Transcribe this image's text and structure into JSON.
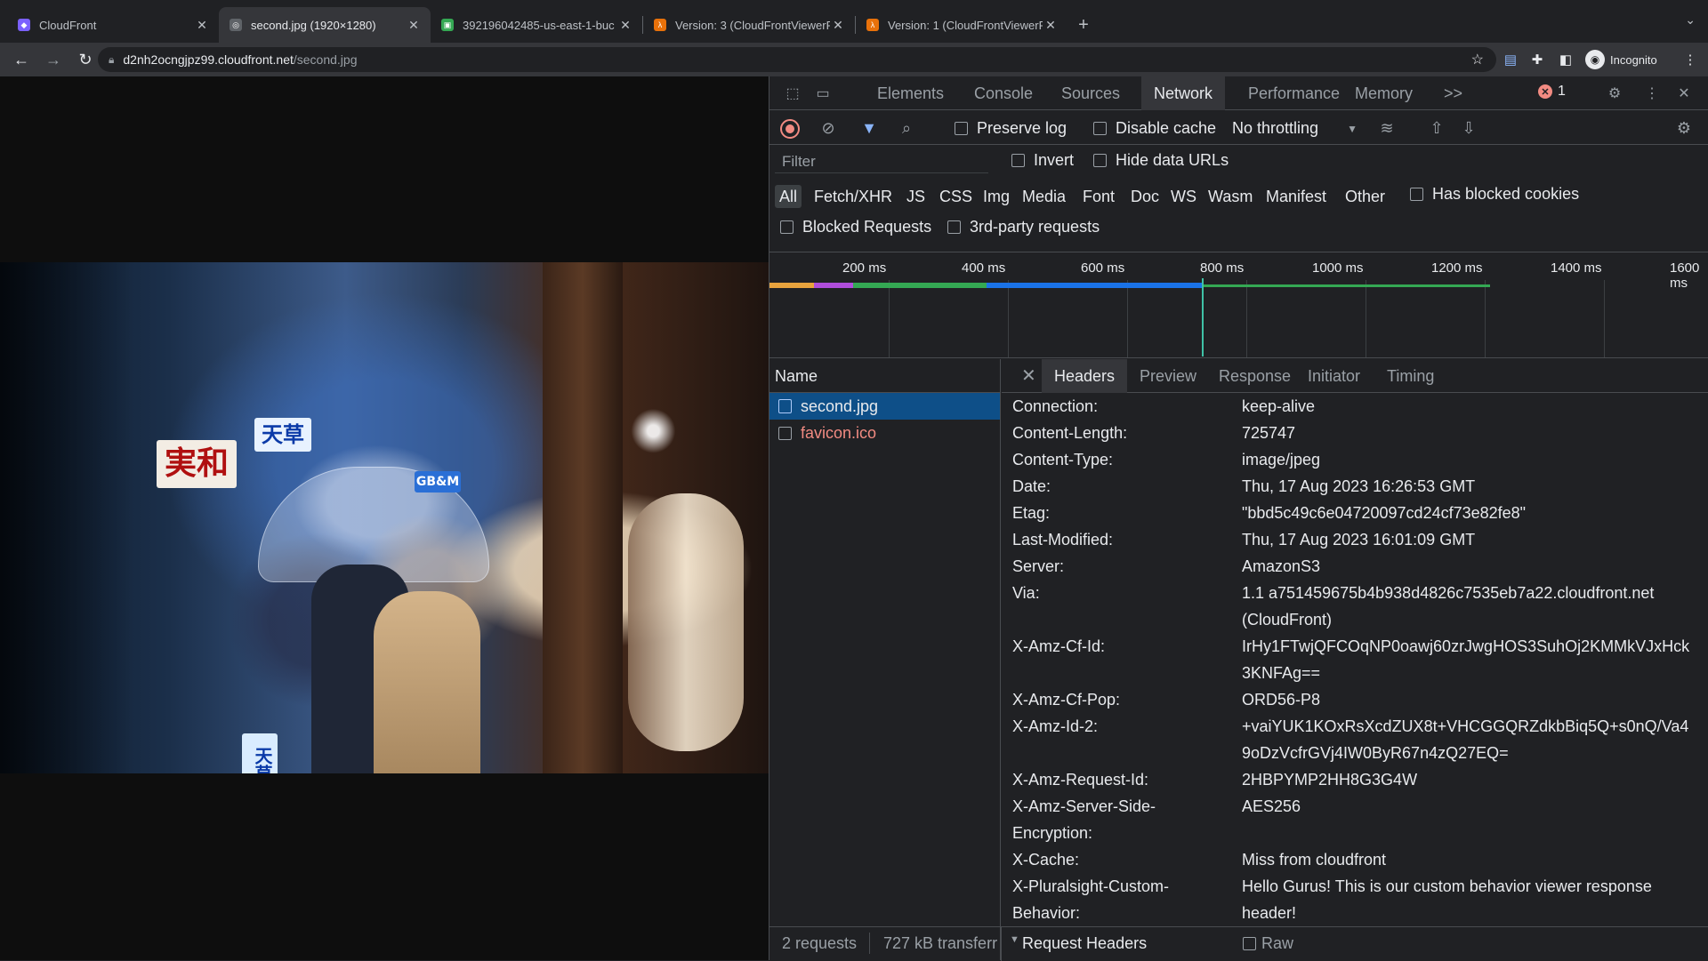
{
  "tabs": [
    {
      "title": "CloudFront",
      "favicon_color": "#7b61ff",
      "favicon_glyph": "◆"
    },
    {
      "title": "second.jpg (1920×1280)",
      "favicon_color": "#5f6368",
      "favicon_glyph": "◎"
    },
    {
      "title": "392196042485-us-east-1-buc",
      "favicon_color": "#34a853",
      "favicon_glyph": "▣"
    },
    {
      "title": "Version: 3 (CloudFrontViewerR",
      "favicon_color": "#e8710a",
      "favicon_glyph": "λ"
    },
    {
      "title": "Version: 1 (CloudFrontViewerR",
      "favicon_color": "#e8710a",
      "favicon_glyph": "λ"
    }
  ],
  "address": {
    "host": "d2nh2ocngjpz99.cloudfront.net",
    "path": "/second.jpg"
  },
  "profile_label": "Incognito",
  "photo_signs": [
    {
      "text": "天草",
      "color": "#0a3aa8",
      "bg": "#e8f2ff"
    },
    {
      "text": "実和",
      "color": "#b01010",
      "bg": "#f3ede4"
    },
    {
      "text": "GB&M",
      "color": "#ffffff",
      "bg": "#2a6fd6"
    },
    {
      "text": "天草",
      "color": "#0a3aa8",
      "bg": "#d9ecff"
    }
  ],
  "devtools": {
    "panels": [
      "Elements",
      "Console",
      "Sources",
      "Network",
      "Performance",
      "Memory"
    ],
    "active_panel": "Network",
    "more": ">>",
    "error_count": "1",
    "preserve_log": "Preserve log",
    "disable_cache": "Disable cache",
    "throttling": "No throttling",
    "filter_placeholder": "Filter",
    "invert": "Invert",
    "hide_data_urls": "Hide data URLs",
    "types": [
      "All",
      "Fetch/XHR",
      "JS",
      "CSS",
      "Img",
      "Media",
      "Font",
      "Doc",
      "WS",
      "Wasm",
      "Manifest",
      "Other"
    ],
    "has_blocked_cookies": "Has blocked cookies",
    "blocked_requests": "Blocked Requests",
    "third_party": "3rd-party requests",
    "timeline_ticks": [
      "200 ms",
      "400 ms",
      "600 ms",
      "800 ms",
      "1000 ms",
      "1200 ms",
      "1400 ms",
      "1600 ms"
    ],
    "name_header": "Name",
    "requests": [
      {
        "name": "second.jpg",
        "selected": true,
        "error": false
      },
      {
        "name": "favicon.ico",
        "selected": false,
        "error": true
      }
    ],
    "summary": {
      "requests": "2 requests",
      "transferred": "727 kB transferr"
    },
    "detail_tabs": [
      "Headers",
      "Preview",
      "Response",
      "Initiator",
      "Timing"
    ],
    "headers": [
      {
        "key": "Connection:",
        "value": "keep-alive"
      },
      {
        "key": "Content-Length:",
        "value": "725747"
      },
      {
        "key": "Content-Type:",
        "value": "image/jpeg"
      },
      {
        "key": "Date:",
        "value": "Thu, 17 Aug 2023 16:26:53 GMT"
      },
      {
        "key": "Etag:",
        "value": "\"bbd5c49c6e04720097cd24cf73e82fe8\""
      },
      {
        "key": "Last-Modified:",
        "value": "Thu, 17 Aug 2023 16:01:09 GMT"
      },
      {
        "key": "Server:",
        "value": "AmazonS3"
      },
      {
        "key": "Via:",
        "value": "1.1 a751459675b4b938d4826c7535eb7a22.cloudfront.net (CloudFront)"
      },
      {
        "key": "X-Amz-Cf-Id:",
        "value": "IrHy1FTwjQFCOqNP0oawj60zrJwgHOS3SuhOj2KMMkVJxHck3KNFAg=="
      },
      {
        "key": "X-Amz-Cf-Pop:",
        "value": "ORD56-P8"
      },
      {
        "key": "X-Amz-Id-2:",
        "value": "+vaiYUK1KOxRsXcdZUX8t+VHCGGQRZdkbBiq5Q+s0nQ/Va49oDzVcfrGVj4IW0ByR67n4zQ27EQ="
      },
      {
        "key": "X-Amz-Request-Id:",
        "value": "2HBPYMP2HH8G3G4W"
      },
      {
        "key": "X-Amz-Server-Side-Encryption:",
        "value": "AES256"
      },
      {
        "key": "X-Cache:",
        "value": "Miss from cloudfront"
      },
      {
        "key": "X-Pluralsight-Custom-Behavior:",
        "value": "Hello Gurus! This is our custom behavior viewer response header!"
      }
    ],
    "request_headers_label": "Request Headers",
    "raw_label": "Raw"
  }
}
